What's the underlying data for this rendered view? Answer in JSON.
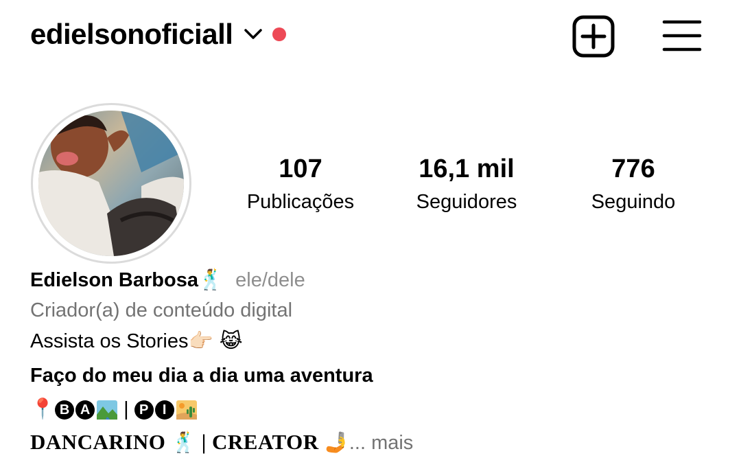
{
  "header": {
    "username": "edielsonoficiall",
    "notification_dot_color": "#ED4956",
    "icons": [
      "chevron-down-icon",
      "new-post-icon",
      "menu-icon"
    ]
  },
  "profile": {
    "avatar_icon": "profile-photo",
    "stats": [
      {
        "value": "107",
        "label": "Publicações"
      },
      {
        "value": "16,1 mil",
        "label": "Seguidores"
      },
      {
        "value": "776",
        "label": "Seguindo"
      }
    ]
  },
  "bio": {
    "name": "Edielson Barbosa",
    "name_emoji": "🕺",
    "pronouns": "ele/dele",
    "category": "Criador(a) de conteúdo digital",
    "line_stories": "Assista os Stories",
    "line_stories_emoji": "👉🏻 😹",
    "tagline": "Faço do meu dia a dia uma aventura",
    "location": {
      "pin": "📍",
      "group1": [
        "B",
        "A"
      ],
      "separator": "|",
      "group2": [
        "P",
        "I"
      ]
    },
    "last_line": {
      "part1": "DANCARINO",
      "emoji1": "🕺",
      "separator": "|",
      "part2": "CREATOR",
      "emoji2": "🤳",
      "more": "... mais"
    }
  }
}
